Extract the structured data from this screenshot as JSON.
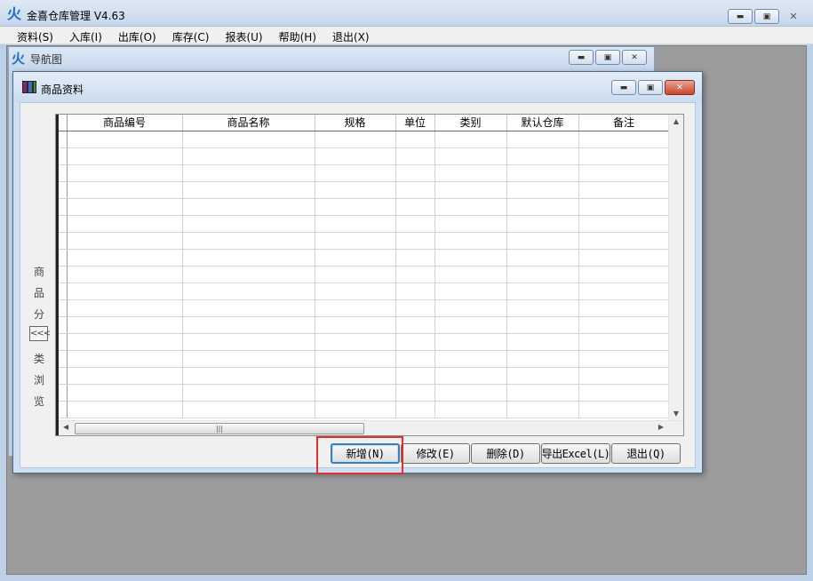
{
  "app": {
    "icon_glyph": "火",
    "title": "金喜仓库管理 V4.63"
  },
  "menu": [
    "资料(S)",
    "入库(I)",
    "出库(O)",
    "库存(C)",
    "报表(U)",
    "帮助(H)",
    "退出(X)"
  ],
  "nav_window": {
    "icon_glyph": "火",
    "title": "导航图"
  },
  "product_window": {
    "title": "商品资料",
    "category_panel": {
      "chars_top": [
        "商",
        "品",
        "分"
      ],
      "collapse_label": "<<<",
      "chars_bottom": [
        "类",
        "浏",
        "览"
      ]
    },
    "table": {
      "columns": [
        "商品编号",
        "商品名称",
        "规格",
        "单位",
        "类别",
        "默认仓库",
        "备注"
      ],
      "rows": []
    },
    "buttons": {
      "add": "新增(N)",
      "edit": "修改(E)",
      "delete": "删除(D)",
      "export": "导出Excel(L)",
      "exit": "退出(Q)"
    }
  },
  "colors": {
    "highlight": "#e03030",
    "mdi_background": "#9c9c9c"
  }
}
